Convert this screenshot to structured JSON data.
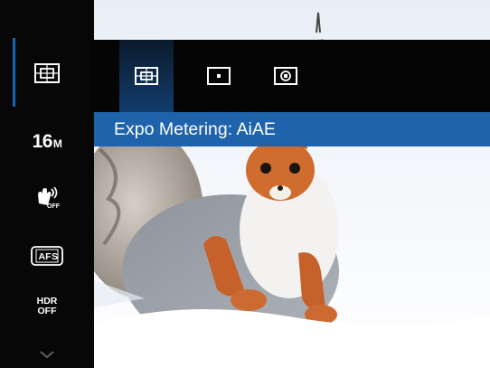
{
  "sidebar": {
    "items": [
      {
        "icon": "metering-aiae-icon"
      },
      {
        "value": "16",
        "unit": "M"
      },
      {
        "icon": "stabilizer-off-icon"
      },
      {
        "icon": "autofocus-single-icon"
      },
      {
        "line1": "HDR",
        "line2": "OFF"
      },
      {
        "icon": "chevron-down-icon"
      }
    ]
  },
  "metering": {
    "options": [
      {
        "icon": "metering-aiae-icon",
        "selected": true
      },
      {
        "icon": "metering-spot-icon",
        "selected": false
      },
      {
        "icon": "metering-center-icon",
        "selected": false
      }
    ],
    "label": "Expo Metering: AiAE"
  },
  "colors": {
    "accent": "#1f63ac",
    "sidebar_bg": "#070707"
  }
}
